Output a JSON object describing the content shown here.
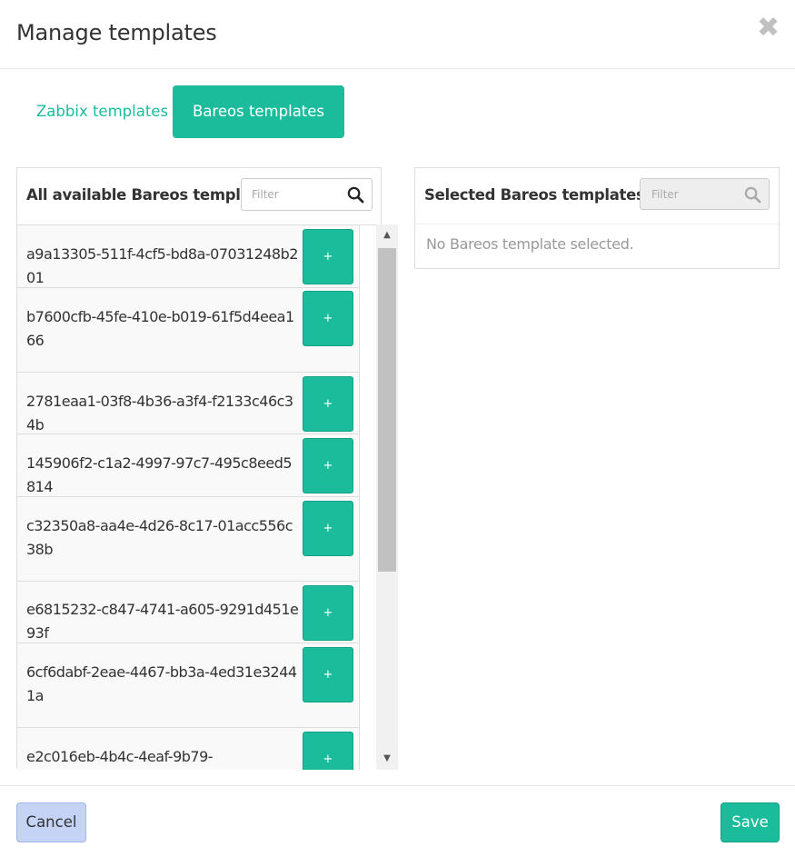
{
  "modal": {
    "title": "Manage templates",
    "close_label": "✖"
  },
  "tabs": [
    {
      "label": "Zabbix templates",
      "active": false
    },
    {
      "label": "Bareos templates",
      "active": true
    }
  ],
  "available": {
    "title": "All available Bareos templates",
    "filter_placeholder": "Filter",
    "add_label": "+",
    "items": [
      "a9a13305-511f-4cf5-bd8a-07031248b201",
      "b7600cfb-45fe-410e-b019-61f5d4eea166",
      "2781eaa1-03f8-4b36-a3f4-f2133c46c34b",
      "145906f2-c1a2-4997-97c7-495c8eed5814",
      "c32350a8-aa4e-4d26-8c17-01acc556c38b",
      "e6815232-c847-4741-a605-9291d451e93f",
      "6cf6dabf-2eae-4467-bb3a-4ed31e32441a",
      "e2c016eb-4b4c-4eaf-9b79-"
    ]
  },
  "selected": {
    "title": "Selected Bareos templates",
    "filter_placeholder": "Filter",
    "empty_text": "No Bareos template selected."
  },
  "footer": {
    "cancel_label": "Cancel",
    "save_label": "Save"
  },
  "colors": {
    "accent": "#1abc9c",
    "cancel_bg": "#c4d3f6"
  }
}
